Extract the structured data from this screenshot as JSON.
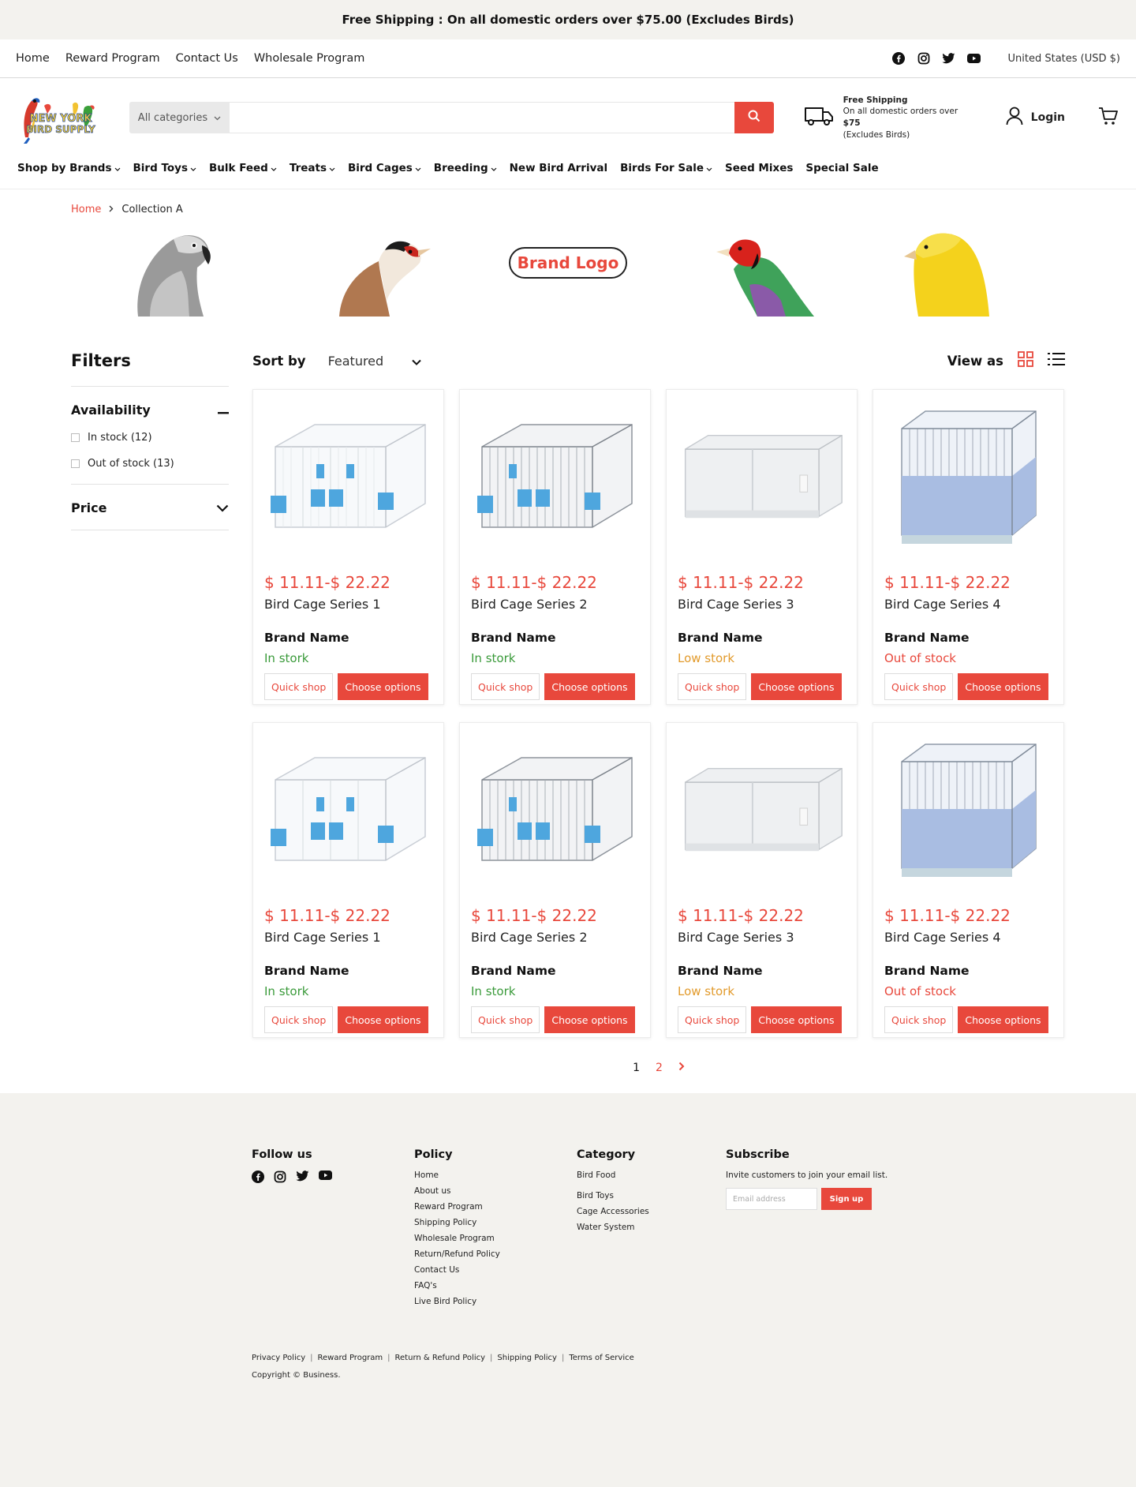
{
  "announcement": "Free Shipping : On all domestic orders over $75.00 (Excludes Birds)",
  "utility_nav": [
    "Home",
    "Reward Program",
    "Contact Us",
    "Wholesale Program"
  ],
  "currency": "United States (USD $)",
  "header": {
    "logo_text": "NEW YORK BIRD SUPPLY",
    "category_select": "All categories",
    "search_placeholder": "",
    "shipping_title": "Free Shipping",
    "shipping_line_prefix": "On all domestic orders over ",
    "shipping_amount": "$75",
    "shipping_line2": "(Excludes Birds)",
    "login": "Login"
  },
  "main_nav": [
    {
      "label": "Shop by Brands",
      "dropdown": true
    },
    {
      "label": "Bird Toys",
      "dropdown": true
    },
    {
      "label": "Bulk Feed",
      "dropdown": true
    },
    {
      "label": "Treats",
      "dropdown": true
    },
    {
      "label": "Bird Cages",
      "dropdown": true
    },
    {
      "label": "Breeding",
      "dropdown": true
    },
    {
      "label": "New Bird Arrival",
      "dropdown": false
    },
    {
      "label": "Birds For Sale",
      "dropdown": true
    },
    {
      "label": "Seed Mixes",
      "dropdown": false
    },
    {
      "label": "Special Sale",
      "dropdown": false
    }
  ],
  "breadcrumb": {
    "home": "Home",
    "current": "Collection A"
  },
  "banner": {
    "brand_logo": "Brand Logo"
  },
  "filters": {
    "title": "Filters",
    "availability": "Availability",
    "options": [
      "In stock (12)",
      "Out of stock (13)"
    ],
    "price": "Price"
  },
  "toolbar": {
    "sort_label": "Sort by",
    "sort_value": "Featured",
    "view_label": "View as"
  },
  "buttons": {
    "quick": "Quick shop",
    "choose": "Choose options"
  },
  "products": [
    {
      "price": "$ 11.11-$ 22.22",
      "name": "Bird Cage Series 1",
      "brand": "Brand Name",
      "stock": "In stork",
      "stock_color": "#3a9a3a",
      "image": "cage-blue-feeders"
    },
    {
      "price": "$ 11.11-$ 22.22",
      "name": "Bird Cage Series 2",
      "brand": "Brand Name",
      "stock": "In stork",
      "stock_color": "#3a9a3a",
      "image": "cage-grey-blue-feeders"
    },
    {
      "price": "$ 11.11-$ 22.22",
      "name": "Bird Cage Series 3",
      "brand": "Brand Name",
      "stock": "Low stork",
      "stock_color": "#e29a2b",
      "image": "cage-white-panels"
    },
    {
      "price": "$ 11.11-$ 22.22",
      "name": "Bird Cage Series 4",
      "brand": "Brand Name",
      "stock": "Out of stock",
      "stock_color": "#e8483c",
      "image": "cage-blue-base"
    },
    {
      "price": "$ 11.11-$ 22.22",
      "name": "Bird Cage Series 1",
      "brand": "Brand Name",
      "stock": "In stork",
      "stock_color": "#3a9a3a",
      "image": "cage-blue-feeders"
    },
    {
      "price": "$ 11.11-$ 22.22",
      "name": "Bird Cage Series 2",
      "brand": "Brand Name",
      "stock": "In stork",
      "stock_color": "#3a9a3a",
      "image": "cage-grey-blue-feeders"
    },
    {
      "price": "$ 11.11-$ 22.22",
      "name": "Bird Cage Series 3",
      "brand": "Brand Name",
      "stock": "Low stork",
      "stock_color": "#e29a2b",
      "image": "cage-white-panels"
    },
    {
      "price": "$ 11.11-$ 22.22",
      "name": "Bird Cage Series 4",
      "brand": "Brand Name",
      "stock": "Out of stock",
      "stock_color": "#e8483c",
      "image": "cage-blue-base"
    }
  ],
  "pagination": {
    "current": "1",
    "next_page": "2"
  },
  "footer": {
    "follow": "Follow us",
    "policy_title": "Policy",
    "policy_links": [
      "Home",
      "About us",
      "Reward Program",
      "Shipping Policy",
      "Wholesale Program",
      "Return/Refund Policy",
      "Contact Us",
      "FAQ's",
      "Live Bird Policy"
    ],
    "category_title": "Category",
    "category_links": [
      "Bird Food",
      "Bird Toys",
      "Cage Accessories",
      "Water System"
    ],
    "subscribe_title": "Subscribe",
    "subscribe_text": "Invite customers to join your email list.",
    "email_placeholder": "Email address",
    "signup": "Sign up",
    "legal_links": [
      "Privacy Policy",
      "Reward Program",
      "Return  & Refund Policy",
      "Shipping Policy",
      "Terms of Service"
    ],
    "copyright": "Copyright © Business."
  },
  "colors": {
    "accent": "#e8483c",
    "in_stock": "#3a9a3a",
    "low_stock": "#e29a2b",
    "footer_bg": "#f3f2ee"
  }
}
